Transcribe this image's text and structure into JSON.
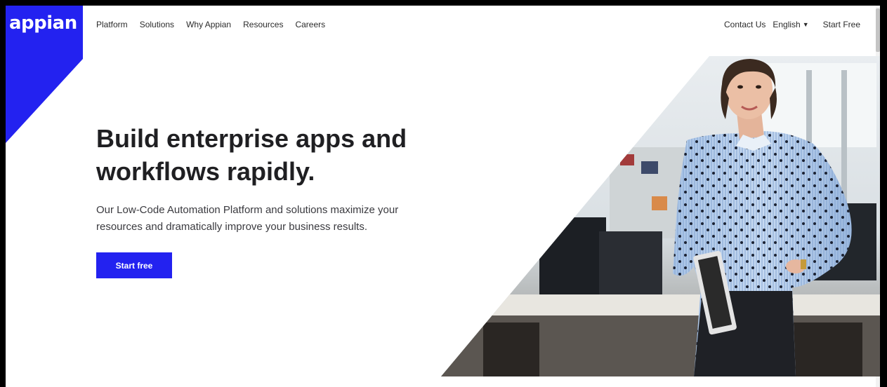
{
  "brand": {
    "logo_text": "appian",
    "color": "#2322f0"
  },
  "nav": {
    "left": [
      "Platform",
      "Solutions",
      "Why Appian",
      "Resources",
      "Careers"
    ],
    "contact": "Contact Us",
    "language": "English",
    "start_free": "Start Free"
  },
  "hero": {
    "title_line1": "Build enterprise apps and",
    "title_line2": "workflows rapidly.",
    "subtitle_line1": "Our Low-Code Automation Platform and solutions maximize your",
    "subtitle_line2": "resources and dramatically improve your business results.",
    "cta_label": "Start free"
  },
  "icons": {
    "language_caret": "caret-down-icon"
  }
}
